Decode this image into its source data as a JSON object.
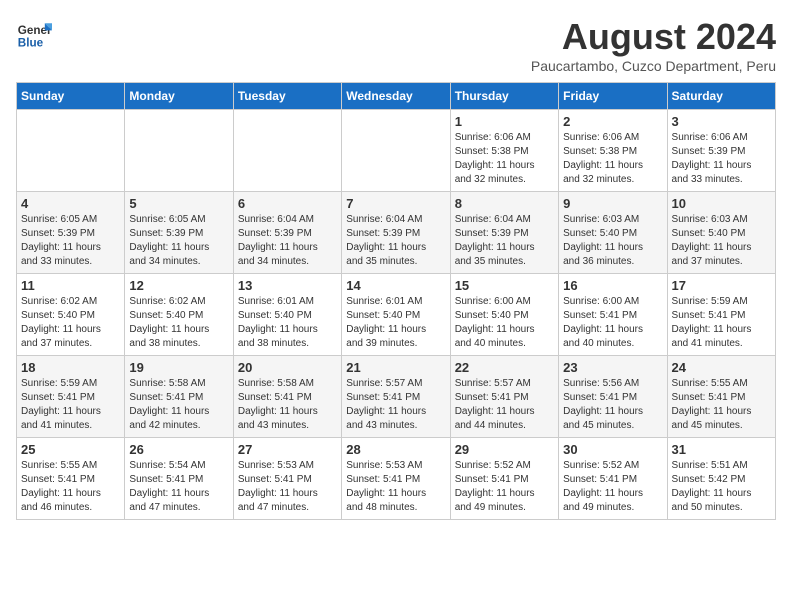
{
  "logo": {
    "general": "General",
    "blue": "Blue"
  },
  "header": {
    "month": "August 2024",
    "location": "Paucartambo, Cuzco Department, Peru"
  },
  "weekdays": [
    "Sunday",
    "Monday",
    "Tuesday",
    "Wednesday",
    "Thursday",
    "Friday",
    "Saturday"
  ],
  "weeks": [
    [
      {
        "day": "",
        "info": ""
      },
      {
        "day": "",
        "info": ""
      },
      {
        "day": "",
        "info": ""
      },
      {
        "day": "",
        "info": ""
      },
      {
        "day": "1",
        "info": "Sunrise: 6:06 AM\nSunset: 5:38 PM\nDaylight: 11 hours\nand 32 minutes."
      },
      {
        "day": "2",
        "info": "Sunrise: 6:06 AM\nSunset: 5:38 PM\nDaylight: 11 hours\nand 32 minutes."
      },
      {
        "day": "3",
        "info": "Sunrise: 6:06 AM\nSunset: 5:39 PM\nDaylight: 11 hours\nand 33 minutes."
      }
    ],
    [
      {
        "day": "4",
        "info": "Sunrise: 6:05 AM\nSunset: 5:39 PM\nDaylight: 11 hours\nand 33 minutes."
      },
      {
        "day": "5",
        "info": "Sunrise: 6:05 AM\nSunset: 5:39 PM\nDaylight: 11 hours\nand 34 minutes."
      },
      {
        "day": "6",
        "info": "Sunrise: 6:04 AM\nSunset: 5:39 PM\nDaylight: 11 hours\nand 34 minutes."
      },
      {
        "day": "7",
        "info": "Sunrise: 6:04 AM\nSunset: 5:39 PM\nDaylight: 11 hours\nand 35 minutes."
      },
      {
        "day": "8",
        "info": "Sunrise: 6:04 AM\nSunset: 5:39 PM\nDaylight: 11 hours\nand 35 minutes."
      },
      {
        "day": "9",
        "info": "Sunrise: 6:03 AM\nSunset: 5:40 PM\nDaylight: 11 hours\nand 36 minutes."
      },
      {
        "day": "10",
        "info": "Sunrise: 6:03 AM\nSunset: 5:40 PM\nDaylight: 11 hours\nand 37 minutes."
      }
    ],
    [
      {
        "day": "11",
        "info": "Sunrise: 6:02 AM\nSunset: 5:40 PM\nDaylight: 11 hours\nand 37 minutes."
      },
      {
        "day": "12",
        "info": "Sunrise: 6:02 AM\nSunset: 5:40 PM\nDaylight: 11 hours\nand 38 minutes."
      },
      {
        "day": "13",
        "info": "Sunrise: 6:01 AM\nSunset: 5:40 PM\nDaylight: 11 hours\nand 38 minutes."
      },
      {
        "day": "14",
        "info": "Sunrise: 6:01 AM\nSunset: 5:40 PM\nDaylight: 11 hours\nand 39 minutes."
      },
      {
        "day": "15",
        "info": "Sunrise: 6:00 AM\nSunset: 5:40 PM\nDaylight: 11 hours\nand 40 minutes."
      },
      {
        "day": "16",
        "info": "Sunrise: 6:00 AM\nSunset: 5:41 PM\nDaylight: 11 hours\nand 40 minutes."
      },
      {
        "day": "17",
        "info": "Sunrise: 5:59 AM\nSunset: 5:41 PM\nDaylight: 11 hours\nand 41 minutes."
      }
    ],
    [
      {
        "day": "18",
        "info": "Sunrise: 5:59 AM\nSunset: 5:41 PM\nDaylight: 11 hours\nand 41 minutes."
      },
      {
        "day": "19",
        "info": "Sunrise: 5:58 AM\nSunset: 5:41 PM\nDaylight: 11 hours\nand 42 minutes."
      },
      {
        "day": "20",
        "info": "Sunrise: 5:58 AM\nSunset: 5:41 PM\nDaylight: 11 hours\nand 43 minutes."
      },
      {
        "day": "21",
        "info": "Sunrise: 5:57 AM\nSunset: 5:41 PM\nDaylight: 11 hours\nand 43 minutes."
      },
      {
        "day": "22",
        "info": "Sunrise: 5:57 AM\nSunset: 5:41 PM\nDaylight: 11 hours\nand 44 minutes."
      },
      {
        "day": "23",
        "info": "Sunrise: 5:56 AM\nSunset: 5:41 PM\nDaylight: 11 hours\nand 45 minutes."
      },
      {
        "day": "24",
        "info": "Sunrise: 5:55 AM\nSunset: 5:41 PM\nDaylight: 11 hours\nand 45 minutes."
      }
    ],
    [
      {
        "day": "25",
        "info": "Sunrise: 5:55 AM\nSunset: 5:41 PM\nDaylight: 11 hours\nand 46 minutes."
      },
      {
        "day": "26",
        "info": "Sunrise: 5:54 AM\nSunset: 5:41 PM\nDaylight: 11 hours\nand 47 minutes."
      },
      {
        "day": "27",
        "info": "Sunrise: 5:53 AM\nSunset: 5:41 PM\nDaylight: 11 hours\nand 47 minutes."
      },
      {
        "day": "28",
        "info": "Sunrise: 5:53 AM\nSunset: 5:41 PM\nDaylight: 11 hours\nand 48 minutes."
      },
      {
        "day": "29",
        "info": "Sunrise: 5:52 AM\nSunset: 5:41 PM\nDaylight: 11 hours\nand 49 minutes."
      },
      {
        "day": "30",
        "info": "Sunrise: 5:52 AM\nSunset: 5:41 PM\nDaylight: 11 hours\nand 49 minutes."
      },
      {
        "day": "31",
        "info": "Sunrise: 5:51 AM\nSunset: 5:42 PM\nDaylight: 11 hours\nand 50 minutes."
      }
    ]
  ]
}
